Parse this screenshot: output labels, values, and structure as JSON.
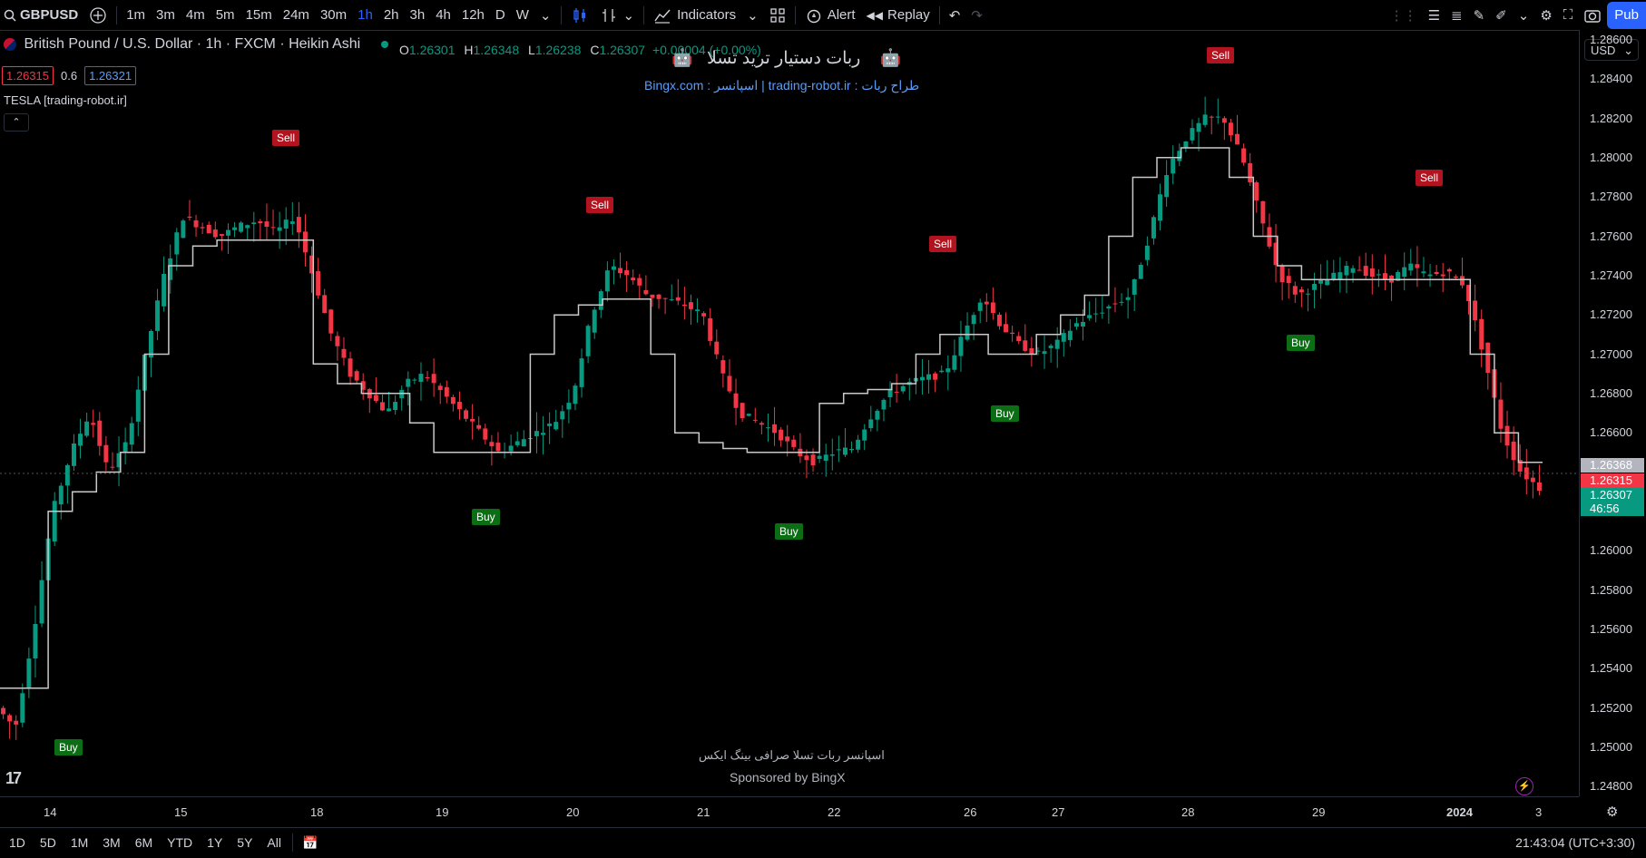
{
  "toolbar": {
    "symbol": "GBPUSD",
    "timeframes": [
      "1m",
      "3m",
      "4m",
      "5m",
      "15m",
      "24m",
      "30m",
      "1h",
      "2h",
      "3h",
      "4h",
      "12h",
      "D",
      "W"
    ],
    "active_timeframe": "1h",
    "indicators_label": "Indicators",
    "alert_label": "Alert",
    "replay_label": "Replay",
    "publish_label": "Pub"
  },
  "legend": {
    "title": "British Pound / U.S. Dollar · 1h · FXCM · Heikin Ashi",
    "o_key": "O",
    "o_val": "1.26301",
    "h_key": "H",
    "h_val": "1.26348",
    "l_key": "L",
    "l_val": "1.26238",
    "c_key": "C",
    "c_val": "1.26307",
    "change": "+0.00004 (+0.00%)",
    "bid": "1.26315",
    "spread": "0.6",
    "ask": "1.26321",
    "indicator": "TESLA [trading-robot.ir]"
  },
  "overlay": {
    "title": "ربات دستیار ترید تسلا",
    "subtitle": "طراح ربات : trading-robot.ir    |    اسپانسر : Bingx.com",
    "bottom_fa": "اسپانسر ربات تسلا صرافی بینگ ایکس",
    "bottom_en": "Sponsored by BingX"
  },
  "price_axis": {
    "currency": "USD",
    "ticks": [
      "1.28600",
      "1.28400",
      "1.28200",
      "1.28000",
      "1.27800",
      "1.27600",
      "1.27400",
      "1.27200",
      "1.27000",
      "1.26800",
      "1.26600",
      "1.26000",
      "1.25800",
      "1.25600",
      "1.25400",
      "1.25200",
      "1.25000",
      "1.24800"
    ],
    "tags": [
      {
        "value": "1.26368",
        "color": "#b2b5be"
      },
      {
        "value": "1.26315",
        "color": "#f23645"
      },
      {
        "value": "1.26307",
        "color": "#089981"
      },
      {
        "value": "46:56",
        "color": "#089981"
      }
    ]
  },
  "time_axis": {
    "ticks": [
      "14",
      "15",
      "18",
      "19",
      "20",
      "21",
      "22",
      "26",
      "27",
      "28",
      "29",
      "2024",
      "3"
    ]
  },
  "bottom": {
    "ranges": [
      "1D",
      "5D",
      "1M",
      "3M",
      "6M",
      "YTD",
      "1Y",
      "5Y",
      "All"
    ],
    "clock": "21:43:04 (UTC+3:30)"
  },
  "chart_data": {
    "type": "candlestick",
    "title": "British Pound / U.S. Dollar · 1h · FXCM · Heikin Ashi",
    "ylim": [
      1.2475,
      1.2865
    ],
    "x_ticks": [
      "14",
      "15",
      "18",
      "19",
      "20",
      "21",
      "22",
      "26",
      "27",
      "28",
      "29",
      "2024",
      "3"
    ],
    "price_path": [
      1.252,
      1.251,
      1.256,
      1.262,
      1.265,
      1.267,
      1.264,
      1.2655,
      1.27,
      1.274,
      1.277,
      1.2765,
      1.276,
      1.2765,
      1.2768,
      1.2762,
      1.277,
      1.274,
      1.271,
      1.269,
      1.268,
      1.267,
      1.2685,
      1.269,
      1.268,
      1.267,
      1.266,
      1.265,
      1.2655,
      1.266,
      1.2665,
      1.268,
      1.272,
      1.2745,
      1.274,
      1.273,
      1.2728,
      1.2725,
      1.272,
      1.269,
      1.267,
      1.2665,
      1.266,
      1.265,
      1.2645,
      1.265,
      1.2652,
      1.2668,
      1.268,
      1.2685,
      1.2688,
      1.269,
      1.271,
      1.273,
      1.2715,
      1.2705,
      1.27,
      1.2705,
      1.2715,
      1.272,
      1.2725,
      1.273,
      1.276,
      1.2795,
      1.281,
      1.282,
      1.282,
      1.28,
      1.277,
      1.274,
      1.273,
      1.2735,
      1.274,
      1.2745,
      1.274,
      1.2738,
      1.2745,
      1.274,
      1.2742,
      1.2735,
      1.27,
      1.266,
      1.264,
      1.2632
    ],
    "trail_line": [
      1.253,
      1.253,
      1.262,
      1.263,
      1.264,
      1.265,
      1.27,
      1.2745,
      1.2755,
      1.2758,
      1.2758,
      1.2758,
      1.2758,
      1.2695,
      1.2685,
      1.268,
      1.268,
      1.2665,
      1.265,
      1.265,
      1.265,
      1.265,
      1.27,
      1.272,
      1.2725,
      1.2728,
      1.2728,
      1.27,
      1.266,
      1.2655,
      1.2652,
      1.265,
      1.265,
      1.265,
      1.2675,
      1.268,
      1.2682,
      1.2685,
      1.27,
      1.271,
      1.271,
      1.27,
      1.27,
      1.271,
      1.272,
      1.273,
      1.276,
      1.279,
      1.28,
      1.2805,
      1.2805,
      1.279,
      1.276,
      1.2745,
      1.2738,
      1.2738,
      1.2738,
      1.2738,
      1.2738,
      1.2738,
      1.2738,
      1.27,
      1.266,
      1.2645
    ],
    "signals": [
      {
        "label": "Buy",
        "x_pos": "14 early",
        "price": 1.25
      },
      {
        "label": "Sell",
        "x_pos": "15 late",
        "price": 1.281
      },
      {
        "label": "Buy",
        "x_pos": "19 late",
        "price": 1.2617
      },
      {
        "label": "Sell",
        "x_pos": "20 late",
        "price": 1.2776
      },
      {
        "label": "Buy",
        "x_pos": "21 late",
        "price": 1.261
      },
      {
        "label": "Sell",
        "x_pos": "26 early",
        "price": 1.2756
      },
      {
        "label": "Buy",
        "x_pos": "26 late",
        "price": 1.267
      },
      {
        "label": "Sell",
        "x_pos": "28 late",
        "price": 1.2852
      },
      {
        "label": "Buy",
        "x_pos": "29 late",
        "price": 1.2706
      },
      {
        "label": "Sell",
        "x_pos": "2024 late",
        "price": 1.279
      }
    ]
  }
}
